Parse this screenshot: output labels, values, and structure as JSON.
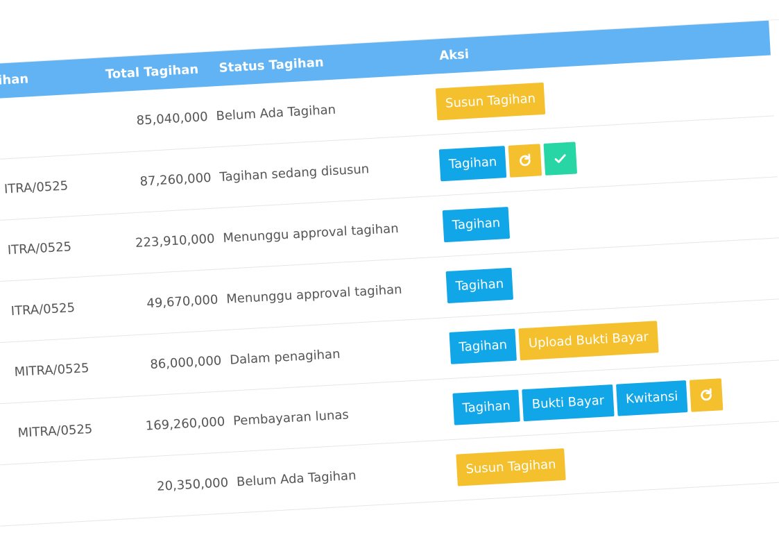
{
  "header": {
    "col_no": "ihan",
    "col_total": "Total Tagihan",
    "col_status": "Status Tagihan",
    "col_aksi": "Aksi"
  },
  "rows": [
    {
      "no": "",
      "total": "85,040,000",
      "status": "Belum Ada Tagihan"
    },
    {
      "no": "ITRA/0525",
      "total": "87,260,000",
      "status": "Tagihan sedang disusun"
    },
    {
      "no": "ITRA/0525",
      "total": "223,910,000",
      "status": "Menunggu approval tagihan"
    },
    {
      "no": "ITRA/0525",
      "total": "49,670,000",
      "status": "Menunggu approval tagihan"
    },
    {
      "no": "MITRA/0525",
      "total": "86,000,000",
      "status": "Dalam penagihan"
    },
    {
      "no": "MITRA/0525",
      "total": "169,260,000",
      "status": "Pembayaran lunas"
    },
    {
      "no": "",
      "total": "20,350,000",
      "status": "Belum Ada Tagihan"
    }
  ],
  "buttons": {
    "susun_tagihan": "Susun Tagihan",
    "tagihan": "Tagihan",
    "upload_bukti_bayar": "Upload Bukti Bayar",
    "bukti_bayar": "Bukti Bayar",
    "kwitansi": "Kwitansi"
  },
  "icons": {
    "refresh": "refresh-icon",
    "check": "check-icon"
  },
  "colors": {
    "header_bg": "#62b3f4",
    "btn_blue": "#10a6e8",
    "btn_yellow": "#f5c02d",
    "btn_green": "#27d6a4"
  }
}
